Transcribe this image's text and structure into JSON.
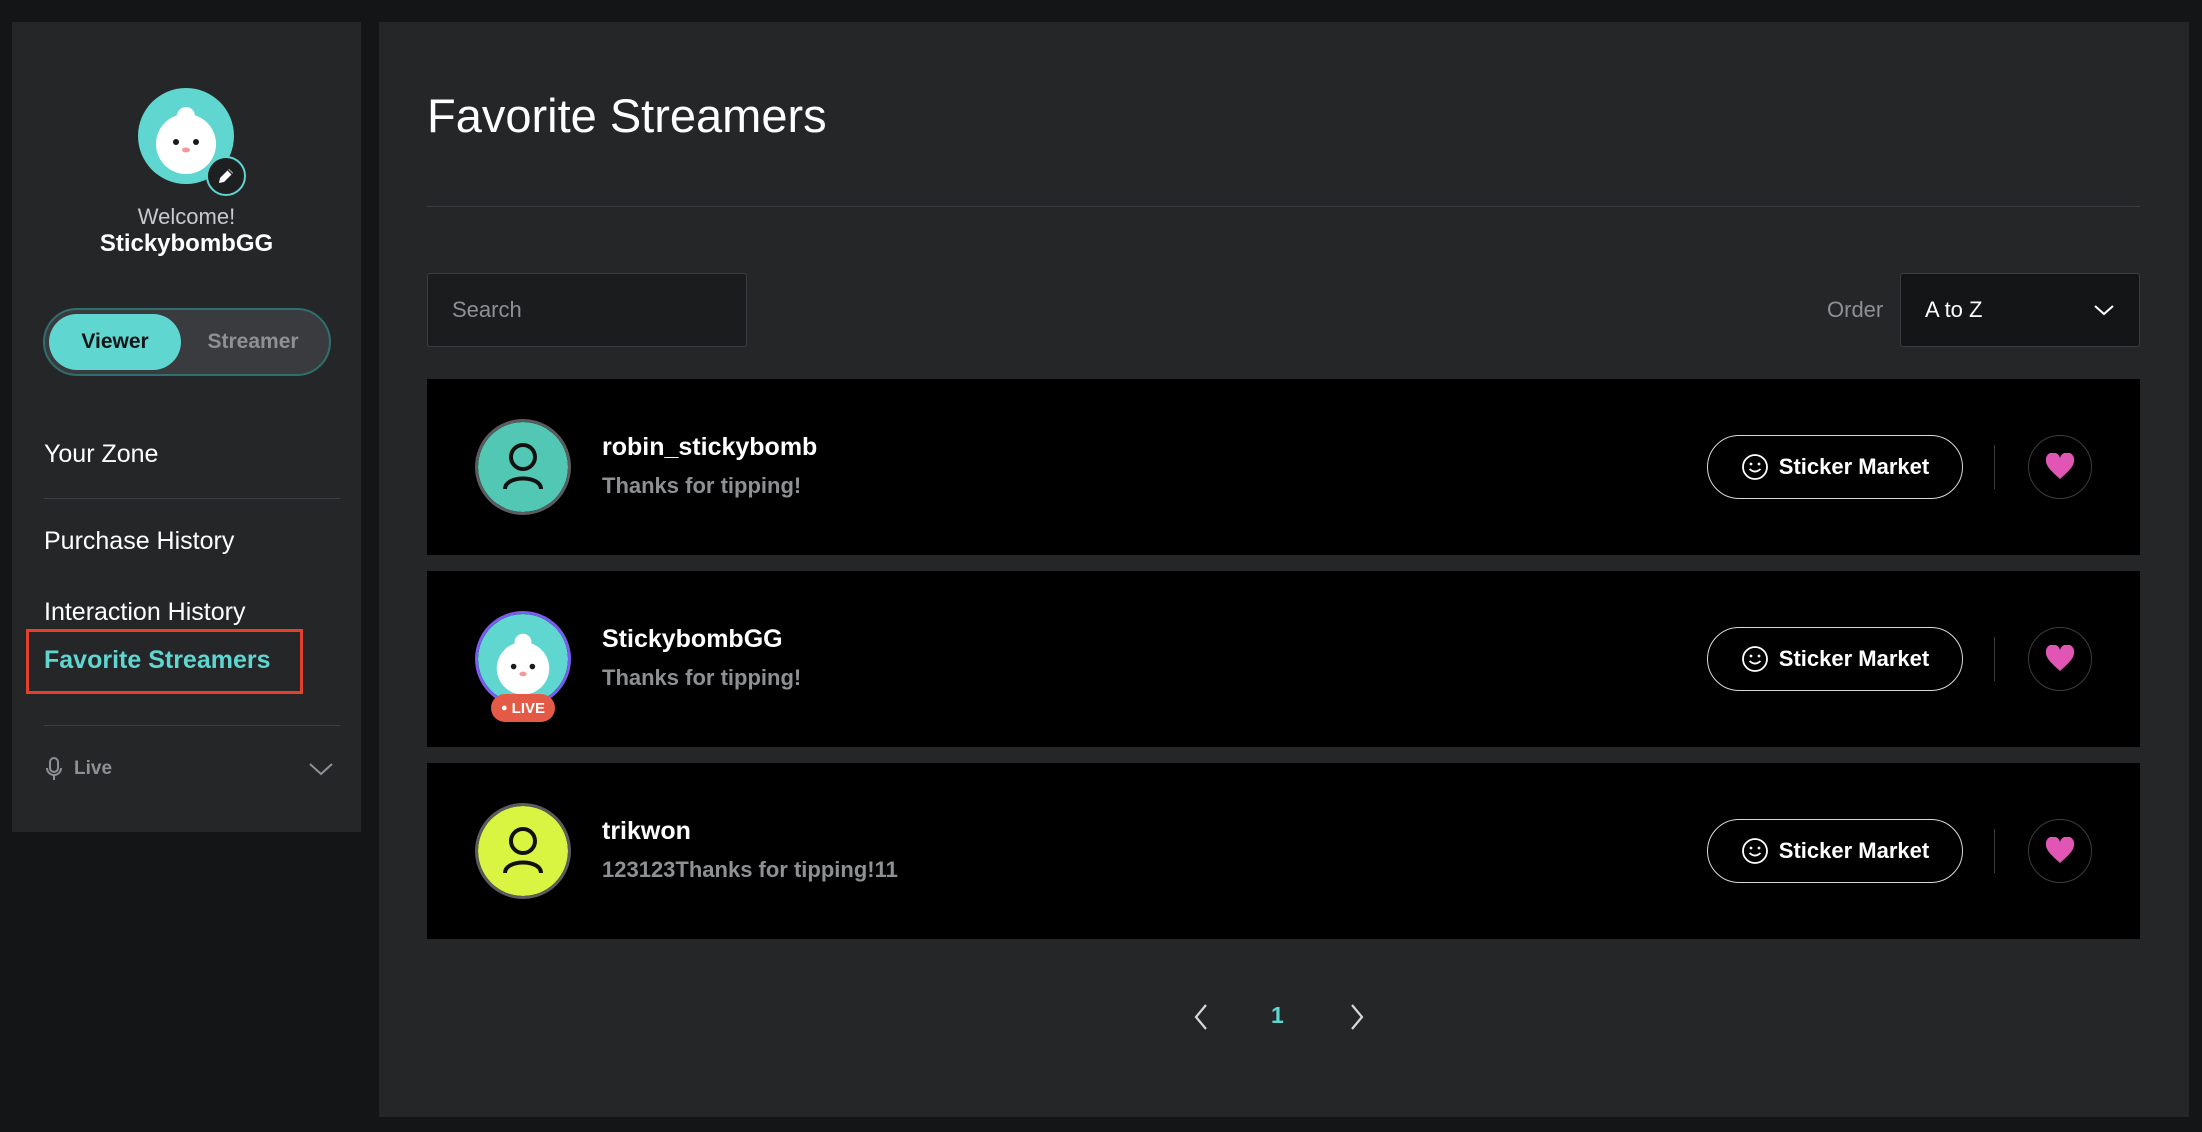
{
  "sidebar": {
    "welcome": "Welcome!",
    "username": "StickybombGG",
    "roles": {
      "viewer": "Viewer",
      "streamer": "Streamer",
      "active": "Viewer"
    },
    "nav": {
      "your_zone": "Your Zone",
      "purchase_history": "Purchase History",
      "interaction_history": "Interaction History",
      "favorite_streamers": "Favorite Streamers"
    },
    "live_section": "Live"
  },
  "main": {
    "title": "Favorite Streamers",
    "search": {
      "placeholder": "Search",
      "value": ""
    },
    "order": {
      "label": "Order",
      "selected": "A to Z"
    },
    "streamers": [
      {
        "name": "robin_stickybomb",
        "message": "Thanks for tipping!",
        "avatar": "person-icon",
        "avatar_color": "#52c7b3",
        "live": false,
        "sticker_label": "Sticker Market",
        "favorited": true
      },
      {
        "name": "StickybombGG",
        "message": "Thanks for tipping!",
        "avatar": "mascot",
        "avatar_color": "#5fd6d0",
        "live": true,
        "live_label": "LIVE",
        "sticker_label": "Sticker Market",
        "favorited": true
      },
      {
        "name": "trikwon",
        "message": "123123Thanks for tipping!11",
        "avatar": "person-icon",
        "avatar_color": "#d9f542",
        "live": false,
        "sticker_label": "Sticker Market",
        "favorited": true
      }
    ],
    "pagination": {
      "current": "1"
    }
  },
  "colors": {
    "accent": "#5fd6d0",
    "heart": "#e156b5",
    "live": "#e45a47",
    "highlight_border": "#e5402a"
  }
}
